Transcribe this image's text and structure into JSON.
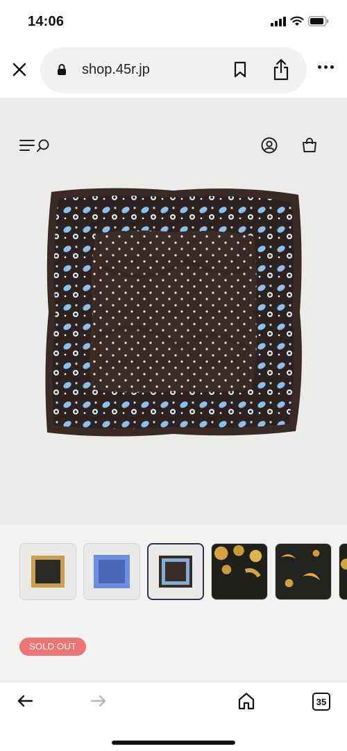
{
  "status": {
    "time": "14:06",
    "icons": [
      "signal-icon",
      "wifi-icon",
      "battery-icon"
    ]
  },
  "browser": {
    "url": "shop.45r.jp",
    "icons": [
      "close-icon",
      "lock-icon",
      "bookmark-icon",
      "share-icon",
      "more-icon"
    ]
  },
  "header": {
    "icons": [
      "menu-icon",
      "search-icon",
      "account-icon",
      "cart-icon"
    ]
  },
  "product": {
    "image": "brown scarf with blue paisley border and white polka dots",
    "thumbnails": [
      {
        "name": "black-gold-scarf"
      },
      {
        "name": "blue-scarf"
      },
      {
        "name": "brown-scarf",
        "active": true
      },
      {
        "name": "black-gold-detail"
      },
      {
        "name": "gold-crescent-detail"
      },
      {
        "name": "gold-partial"
      }
    ],
    "status_badge": "SOLD OUT"
  },
  "bottom_nav": {
    "tab_count": "35",
    "icons": [
      "back-arrow-icon",
      "forward-arrow-icon",
      "home-icon",
      "tabs-icon"
    ]
  },
  "colors": {
    "scarf_brown": "#3a2a25",
    "paisley_blue": "#8cc0e8",
    "badge": "#ee7474",
    "active_thumb_border": "#2a3450"
  }
}
